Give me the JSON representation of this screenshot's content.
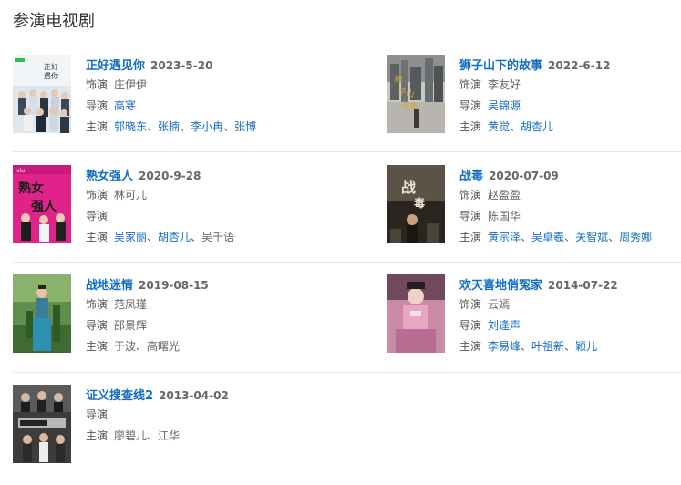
{
  "section": {
    "title": "参演电视剧"
  },
  "dramas": [
    {
      "title": "正好遇见你",
      "date": "2023-5-20",
      "role_label": "饰演",
      "role": "庄伊伊",
      "director_label": "导演",
      "director": "高寒",
      "cast_label": "主演",
      "cast": [
        "郭晓东",
        "张楠",
        "李小冉",
        "张博"
      ],
      "poster_text": "正好遇见你"
    },
    {
      "title": "狮子山下的故事",
      "date": "2022-6-12",
      "role_label": "饰演",
      "role": "李友好",
      "director_label": "导演",
      "director": "吴锦源",
      "cast_label": "主演",
      "cast": [
        "黄觉",
        "胡杏儿"
      ],
      "poster_text": "狮子山下的故事"
    },
    {
      "title": "熟女强人",
      "date": "2020-9-28",
      "role_label": "饰演",
      "role": "林可儿",
      "director_label": "导演",
      "director": "",
      "cast_label": "主演",
      "cast": [
        "吴家丽",
        "胡杏儿",
        "吴千语"
      ],
      "poster_text": "熟女强人"
    },
    {
      "title": "战毒",
      "date": "2020-07-09",
      "role_label": "饰演",
      "role": "赵盈盈",
      "director_label": "导演",
      "director": "陈国华",
      "cast_label": "主演",
      "cast": [
        "黄宗泽",
        "吴卓羲",
        "关智斌",
        "周秀娜"
      ],
      "poster_text": "战毒"
    },
    {
      "title": "战地迷情",
      "date": "2019-08-15",
      "role_label": "饰演",
      "role": "范凤瑾",
      "director_label": "导演",
      "director": "邵景辉",
      "cast_label": "主演",
      "cast": [
        "于波",
        "高曙光"
      ]
    },
    {
      "title": "欢天喜地俏冤家",
      "date": "2014-07-22",
      "role_label": "饰演",
      "role": "云嫣",
      "director_label": "导演",
      "director": "刘逢声",
      "cast_label": "主演",
      "cast": [
        "李易峰",
        "叶祖新",
        "颖儿"
      ]
    },
    {
      "title": "证义搜查线2",
      "date": "2013-04-02",
      "director_label": "导演",
      "director": "",
      "cast_label": "主演",
      "cast": [
        "廖碧儿",
        "江华"
      ]
    }
  ],
  "links": {
    "role": [
      false,
      false,
      false,
      false,
      false,
      false,
      false
    ],
    "director": [
      true,
      true,
      false,
      false,
      false,
      true,
      false
    ],
    "cast": [
      true,
      false,
      true,
      true,
      false,
      true,
      false
    ]
  },
  "colors": {
    "link": "#136ec2",
    "text": "#333333",
    "muted": "#666666",
    "divider": "#e8e8e8"
  }
}
